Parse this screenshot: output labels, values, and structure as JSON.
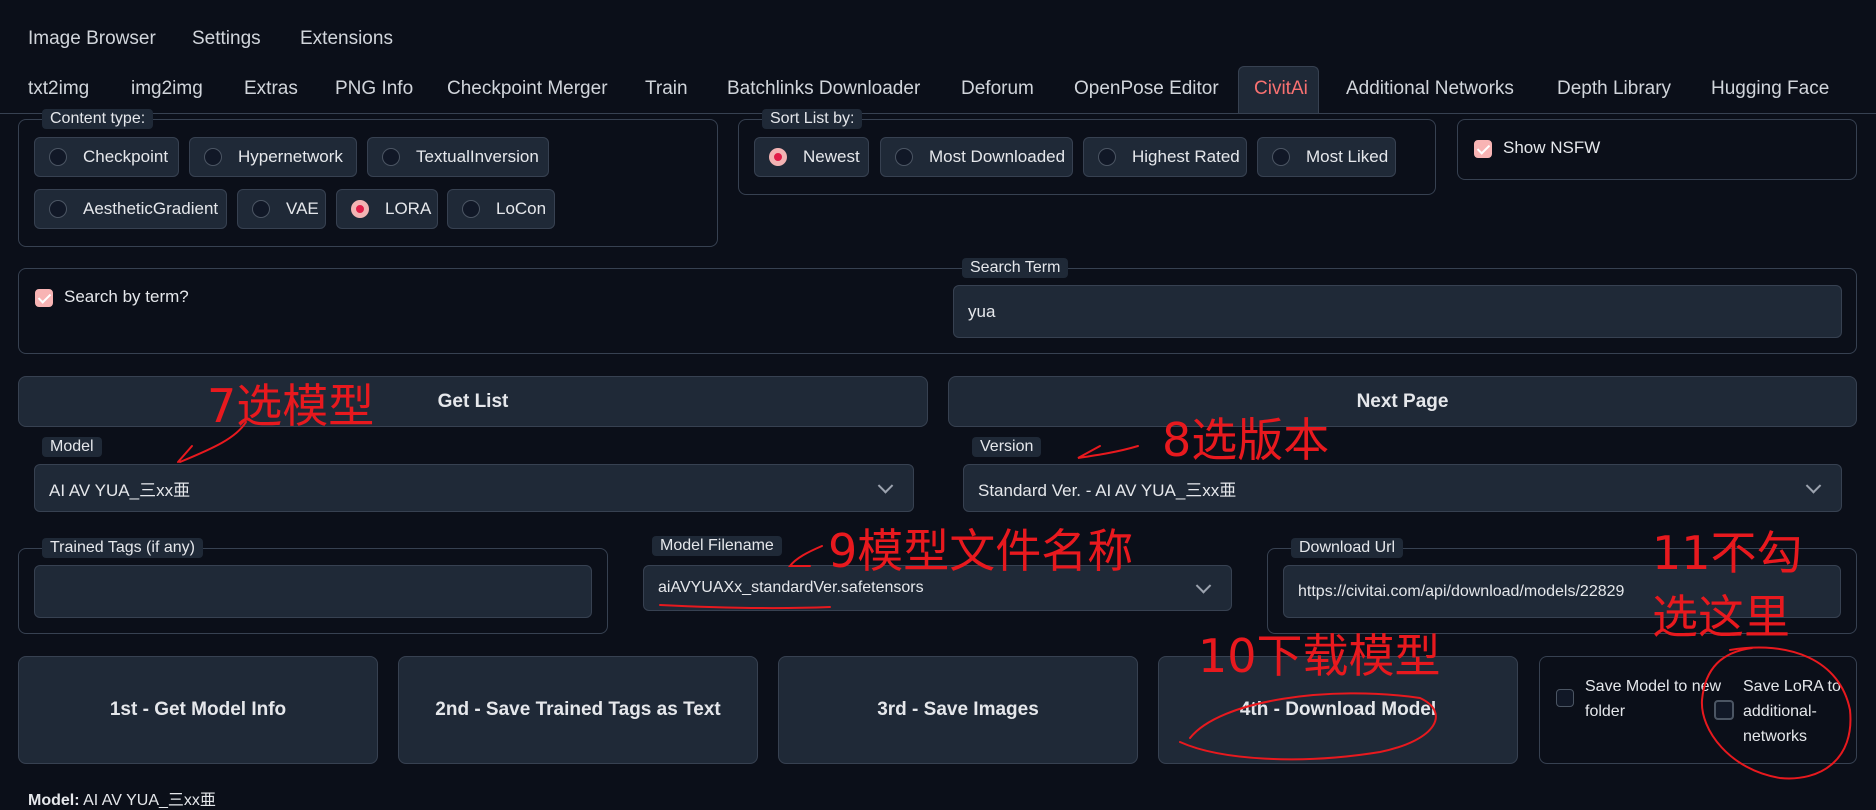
{
  "top_tabs": [
    "Image Browser",
    "Settings",
    "Extensions"
  ],
  "tabs": [
    "txt2img",
    "img2img",
    "Extras",
    "PNG Info",
    "Checkpoint Merger",
    "Train",
    "Batchlinks Downloader",
    "Deforum",
    "OpenPose Editor",
    "CivitAi",
    "Additional Networks",
    "Depth Library",
    "Hugging Face"
  ],
  "active_tab": "CivitAi",
  "content_type": {
    "legend": "Content type:",
    "options": [
      "Checkpoint",
      "Hypernetwork",
      "TextualInversion",
      "AestheticGradient",
      "VAE",
      "LORA",
      "LoCon"
    ],
    "selected": "LORA"
  },
  "sort_list": {
    "legend": "Sort List by:",
    "options": [
      "Newest",
      "Most Downloaded",
      "Highest Rated",
      "Most Liked"
    ],
    "selected": "Newest"
  },
  "show_nsfw": {
    "label": "Show NSFW",
    "checked": true
  },
  "search_by_term": {
    "label": "Search by term?",
    "checked": true
  },
  "search_term": {
    "label": "Search Term",
    "value": "yua"
  },
  "get_list_label": "Get List",
  "next_page_label": "Next Page",
  "model": {
    "label": "Model",
    "value": "AI AV YUA_三xx亜"
  },
  "version": {
    "label": "Version",
    "value": "Standard Ver. - AI AV YUA_三xx亜"
  },
  "trained_tags": {
    "label": "Trained Tags (if any)",
    "value": ""
  },
  "model_filename": {
    "label": "Model Filename",
    "value": "aiAVYUAXx_standardVer.safetensors"
  },
  "download_url": {
    "label": "Download Url",
    "value": "https://civitai.com/api/download/models/22829"
  },
  "action_buttons": [
    "1st - Get Model Info",
    "2nd - Save Trained Tags as Text",
    "3rd - Save Images",
    "4th - Download Model"
  ],
  "save_model_folder": {
    "label": "Save Model to new folder",
    "checked": false
  },
  "save_lora": {
    "label": "Save LoRA to additional-networks",
    "checked": false
  },
  "footer": {
    "prefix": "Model:",
    "value": "AI AV YUA_三xx亜"
  },
  "annotations": {
    "a7": "7选模型",
    "a8": "8选版本",
    "a9": "9模型文件名称",
    "a10": "10下载模型",
    "a11_line1": "11不勾",
    "a11_line2": "选这里"
  },
  "colors": {
    "accent": "#f87171",
    "annotation": "#e8191e",
    "background": "#0b0f19",
    "panel": "#1f2937"
  }
}
